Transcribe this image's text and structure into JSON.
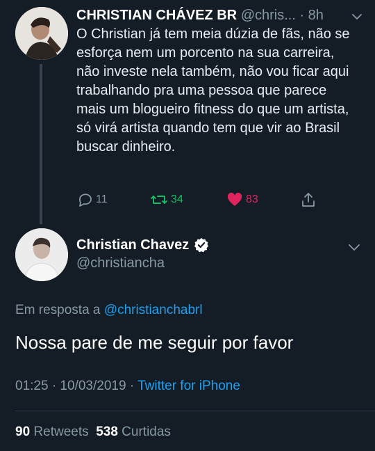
{
  "parent_tweet": {
    "display_name": "CHRISTIAN CHÁVEZ BR",
    "handle": "@chris...",
    "time": "· 8h",
    "text": "O Christian já tem meia dúzia de fãs, não se esforça nem um porcento na sua carreira, não investe nela também, não vou ficar aqui trabalhando pra uma pessoa que parece mais um blogueiro fitness do que um artista, só virá artista quando tem que vir ao Brasil buscar dinheiro.",
    "actions": {
      "reply_count": "11",
      "retweet_count": "34",
      "like_count": "83"
    },
    "icons": [
      "avatar",
      "chevron-down-icon",
      "reply-icon",
      "retweet-icon",
      "heart-icon",
      "share-icon"
    ]
  },
  "main_tweet": {
    "display_name": "Christian Chavez",
    "handle": "@christiancha",
    "reply_prefix": "Em resposta a",
    "reply_mention": "@christianchabrl",
    "text": "Nossa pare de me seguir por favor",
    "timestamp": "01:25 · 10/03/2019 ·",
    "source": "Twitter for iPhone",
    "retweets_count": "90",
    "retweets_label": "Retweets",
    "likes_count": "538",
    "likes_label": "Curtidas",
    "icons": [
      "avatar",
      "verified-badge-icon",
      "chevron-down-icon"
    ]
  },
  "colors": {
    "background": "#141d26",
    "accent": "#1da1f2",
    "retweet": "#17bf63",
    "like": "#e0245e",
    "muted": "#8899a6"
  }
}
